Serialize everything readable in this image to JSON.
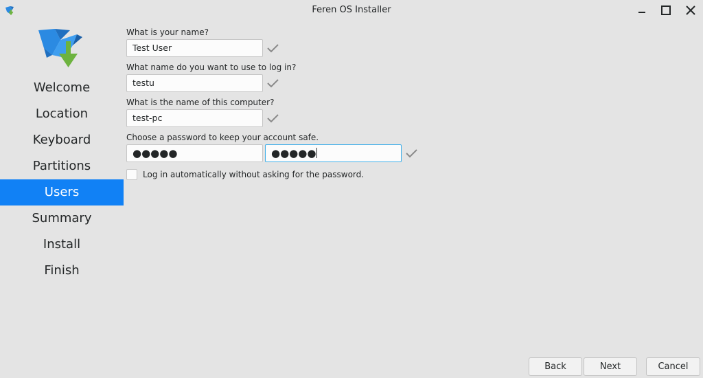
{
  "window": {
    "title": "Feren OS Installer",
    "icons": {
      "app": "feren-bird-icon",
      "minimize": "minimize-icon",
      "maximize": "maximize-icon",
      "close": "close-icon"
    }
  },
  "sidebar": {
    "logo": "feren-installer-logo",
    "steps": [
      {
        "label": "Welcome",
        "active": false
      },
      {
        "label": "Location",
        "active": false
      },
      {
        "label": "Keyboard",
        "active": false
      },
      {
        "label": "Partitions",
        "active": false
      },
      {
        "label": "Users",
        "active": true
      },
      {
        "label": "Summary",
        "active": false
      },
      {
        "label": "Install",
        "active": false
      },
      {
        "label": "Finish",
        "active": false
      }
    ]
  },
  "form": {
    "name": {
      "label": "What is your name?",
      "value": "Test User"
    },
    "login": {
      "label": "What name do you want to use to log in?",
      "value": "testu"
    },
    "hostname": {
      "label": "What is the name of this computer?",
      "value": "test-pc"
    },
    "password": {
      "label": "Choose a password to keep your account safe.",
      "value": "●●●●●",
      "confirm_value": "●●●●●"
    },
    "autologin": {
      "label": "Log in automatically without asking for the password.",
      "checked": false
    },
    "valid_icon": "checkmark-icon"
  },
  "buttons": {
    "back": "Back",
    "next": "Next",
    "cancel": "Cancel"
  },
  "colors": {
    "accent": "#1181f5",
    "background": "#e4e4e4",
    "check": "#8a8a8a"
  }
}
